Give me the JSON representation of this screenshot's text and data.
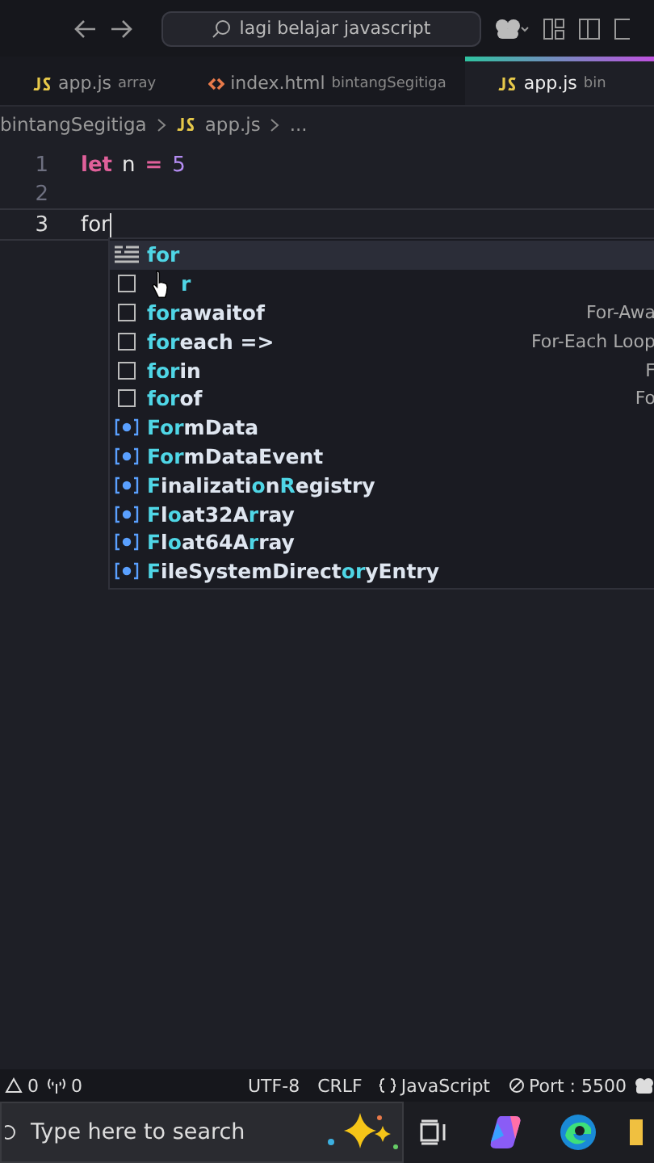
{
  "title_bar": {
    "search": "lagi belajar javascript"
  },
  "tabs": [
    {
      "kind": "js",
      "name": "app.js",
      "folder": "array",
      "selected": false
    },
    {
      "kind": "html",
      "name": "index.html",
      "folder": "bintangSegitiga",
      "selected": false
    },
    {
      "kind": "js",
      "name": "app.js",
      "folder": "bin",
      "selected": true
    }
  ],
  "breadcrumb": [
    "bintangSegitiga",
    "app.js",
    "..."
  ],
  "editor": {
    "lines": [
      {
        "number": "1",
        "kind": "let",
        "keyword": "let",
        "name": "n",
        "op": "=",
        "value": "5"
      },
      {
        "number": "2",
        "kind": "empty"
      },
      {
        "number": "3",
        "kind": "text",
        "text": "for"
      }
    ]
  },
  "suggestions": [
    {
      "kind": "snippet",
      "selected": true,
      "parts": [
        {
          "t": "for",
          "hl": true
        }
      ]
    },
    {
      "kind": "box",
      "selected": false,
      "pointer_over": true,
      "parts": [
        {
          "t": "r",
          "hl": true
        }
      ]
    },
    {
      "kind": "box",
      "selected": false,
      "parts": [
        {
          "t": "for",
          "hl": true
        },
        {
          "t": "awaitof",
          "hl": false
        }
      ],
      "detail": "For-Awa"
    },
    {
      "kind": "box",
      "selected": false,
      "parts": [
        {
          "t": "for",
          "hl": true
        },
        {
          "t": "each =>",
          "hl": false
        }
      ],
      "detail": "For-Each Loop"
    },
    {
      "kind": "box",
      "selected": false,
      "parts": [
        {
          "t": "for",
          "hl": true
        },
        {
          "t": "in",
          "hl": false
        }
      ],
      "detail": "F"
    },
    {
      "kind": "box",
      "selected": false,
      "parts": [
        {
          "t": "for",
          "hl": true
        },
        {
          "t": "of",
          "hl": false
        }
      ],
      "detail": "Fo"
    },
    {
      "kind": "class",
      "selected": false,
      "parts": [
        {
          "t": "For",
          "hl": true
        },
        {
          "t": "mData",
          "hl": false
        }
      ]
    },
    {
      "kind": "class",
      "selected": false,
      "parts": [
        {
          "t": "For",
          "hl": true
        },
        {
          "t": "mDataEvent",
          "hl": false
        }
      ]
    },
    {
      "kind": "class",
      "selected": false,
      "parts": [
        {
          "t": "F",
          "hl": true
        },
        {
          "t": "inalizati",
          "hl": false
        },
        {
          "t": "o",
          "hl": true
        },
        {
          "t": "n",
          "hl": false
        },
        {
          "t": "R",
          "hl": true
        },
        {
          "t": "egistry",
          "hl": false
        }
      ]
    },
    {
      "kind": "class",
      "selected": false,
      "parts": [
        {
          "t": "F",
          "hl": true
        },
        {
          "t": "l",
          "hl": false
        },
        {
          "t": "o",
          "hl": true
        },
        {
          "t": "at32A",
          "hl": false
        },
        {
          "t": "r",
          "hl": true
        },
        {
          "t": "ray",
          "hl": false
        }
      ]
    },
    {
      "kind": "class",
      "selected": false,
      "parts": [
        {
          "t": "F",
          "hl": true
        },
        {
          "t": "l",
          "hl": false
        },
        {
          "t": "o",
          "hl": true
        },
        {
          "t": "at64A",
          "hl": false
        },
        {
          "t": "r",
          "hl": true
        },
        {
          "t": "ray",
          "hl": false
        }
      ]
    },
    {
      "kind": "class",
      "selected": false,
      "parts": [
        {
          "t": "F",
          "hl": true
        },
        {
          "t": "ileSystemDirect",
          "hl": false
        },
        {
          "t": "or",
          "hl": true
        },
        {
          "t": "yEntry",
          "hl": false
        }
      ]
    }
  ],
  "status_bar": {
    "warnings": "0",
    "ports": "0",
    "encoding": "UTF-8",
    "eol": "CRLF",
    "language": "JavaScript",
    "port": "Port : 5500"
  },
  "taskbar": {
    "search_placeholder": "Type here to search"
  }
}
